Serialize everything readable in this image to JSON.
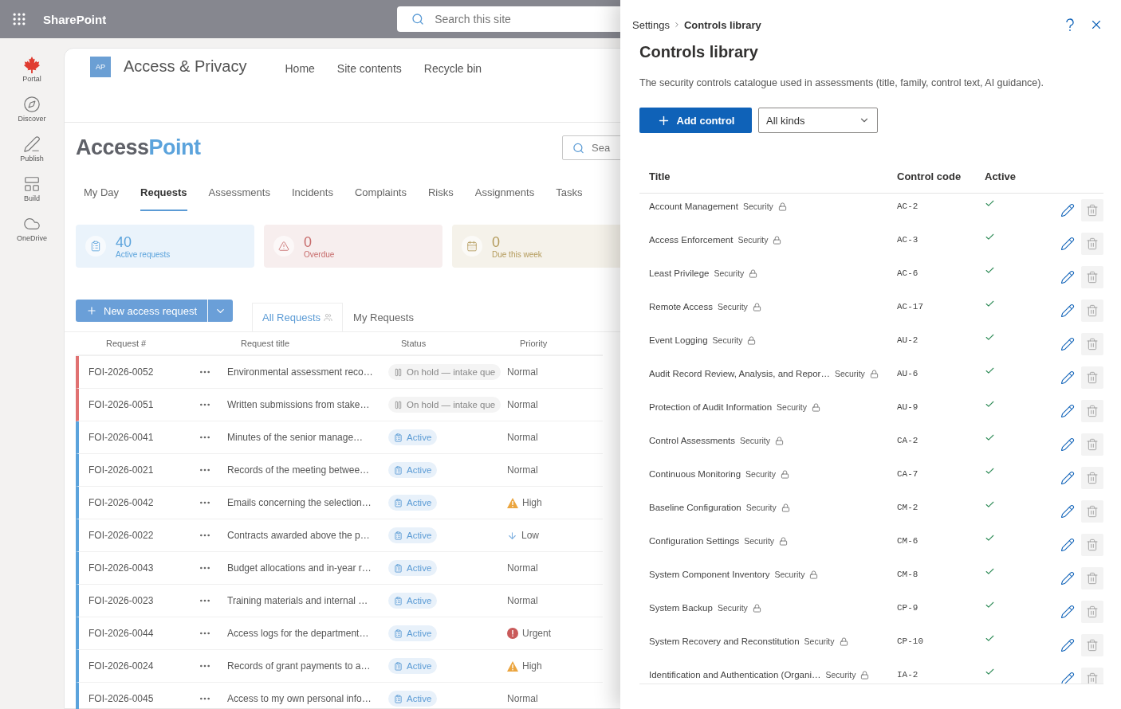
{
  "suite_bar": {
    "app_name": "SharePoint",
    "search": {
      "placeholder": "Search this site"
    }
  },
  "rail": [
    {
      "label": "Portal",
      "kind": "portal"
    },
    {
      "label": "Discover",
      "kind": "discover"
    },
    {
      "label": "Publish",
      "kind": "publish"
    },
    {
      "label": "Build",
      "kind": "build"
    },
    {
      "label": "OneDrive",
      "kind": "onedrive"
    }
  ],
  "site_header": {
    "logo": "AP",
    "title": "Access & Privacy",
    "nav": [
      "Home",
      "Site contents",
      "Recycle bin"
    ]
  },
  "app": {
    "brand": {
      "part1": "Access",
      "part2": "Point"
    },
    "search": {
      "placeholder": "Sea"
    },
    "tabs": [
      {
        "label": "My Day",
        "selected": false
      },
      {
        "label": "Requests",
        "selected": true
      },
      {
        "label": "Assessments",
        "selected": false
      },
      {
        "label": "Incidents",
        "selected": false
      },
      {
        "label": "Complaints",
        "selected": false
      },
      {
        "label": "Risks",
        "selected": false
      },
      {
        "label": "Assignments",
        "selected": false
      },
      {
        "label": "Tasks",
        "selected": false
      }
    ],
    "stats": [
      {
        "kind": "active",
        "value": "40",
        "label": "Active requests"
      },
      {
        "kind": "overdue",
        "value": "0",
        "label": "Overdue"
      },
      {
        "kind": "due",
        "value": "0",
        "label": "Due this week"
      }
    ],
    "new_button": "New access request",
    "views": [
      {
        "label": "All Requests",
        "selected": true
      },
      {
        "label": "My Requests",
        "selected": false
      }
    ],
    "table": {
      "columns": [
        "Request #",
        "Request title",
        "Status",
        "Priority"
      ],
      "rows": [
        {
          "id": "FOI-2026-0052",
          "title": "Environmental assessment reco…",
          "status": {
            "kind": "on_hold",
            "label": "On hold — intake que"
          },
          "priority": {
            "kind": "normal",
            "label": "Normal"
          }
        },
        {
          "id": "FOI-2026-0051",
          "title": "Written submissions from stake…",
          "status": {
            "kind": "on_hold",
            "label": "On hold — intake que"
          },
          "priority": {
            "kind": "normal",
            "label": "Normal"
          }
        },
        {
          "id": "FOI-2026-0041",
          "title": "Minutes of the senior manage…",
          "status": {
            "kind": "active",
            "label": "Active"
          },
          "priority": {
            "kind": "normal",
            "label": "Normal"
          }
        },
        {
          "id": "FOI-2026-0021",
          "title": "Records of the meeting betwee…",
          "status": {
            "kind": "active",
            "label": "Active"
          },
          "priority": {
            "kind": "normal",
            "label": "Normal"
          }
        },
        {
          "id": "FOI-2026-0042",
          "title": "Emails concerning the selection…",
          "status": {
            "kind": "active",
            "label": "Active"
          },
          "priority": {
            "kind": "high",
            "label": "High"
          }
        },
        {
          "id": "FOI-2026-0022",
          "title": "Contracts awarded above the p…",
          "status": {
            "kind": "active",
            "label": "Active"
          },
          "priority": {
            "kind": "low",
            "label": "Low"
          }
        },
        {
          "id": "FOI-2026-0043",
          "title": "Budget allocations and in-year r…",
          "status": {
            "kind": "active",
            "label": "Active"
          },
          "priority": {
            "kind": "normal",
            "label": "Normal"
          }
        },
        {
          "id": "FOI-2026-0023",
          "title": "Training materials and internal …",
          "status": {
            "kind": "active",
            "label": "Active"
          },
          "priority": {
            "kind": "normal",
            "label": "Normal"
          }
        },
        {
          "id": "FOI-2026-0044",
          "title": "Access logs for the department…",
          "status": {
            "kind": "active",
            "label": "Active"
          },
          "priority": {
            "kind": "urgent",
            "label": "Urgent"
          }
        },
        {
          "id": "FOI-2026-0024",
          "title": "Records of grant payments to a…",
          "status": {
            "kind": "active",
            "label": "Active"
          },
          "priority": {
            "kind": "high",
            "label": "High"
          }
        },
        {
          "id": "FOI-2026-0045",
          "title": "Access to my own personal info…",
          "status": {
            "kind": "active",
            "label": "Active"
          },
          "priority": {
            "kind": "normal",
            "label": "Normal"
          }
        }
      ]
    }
  },
  "panel": {
    "breadcrumb": [
      "Settings",
      "Controls library"
    ],
    "title": "Controls library",
    "description": "The security controls catalogue used in assessments (title, family, control text, AI guidance).",
    "add_button": "Add control",
    "filter": "All kinds",
    "columns": [
      "Title",
      "Control code",
      "Active"
    ],
    "rows": [
      {
        "title": "Account Management",
        "family": "Security",
        "code": "AC-2",
        "active": true
      },
      {
        "title": "Access Enforcement",
        "family": "Security",
        "code": "AC-3",
        "active": true
      },
      {
        "title": "Least Privilege",
        "family": "Security",
        "code": "AC-6",
        "active": true
      },
      {
        "title": "Remote Access",
        "family": "Security",
        "code": "AC-17",
        "active": true
      },
      {
        "title": "Event Logging",
        "family": "Security",
        "code": "AU-2",
        "active": true
      },
      {
        "title": "Audit Record Review, Analysis, and Repor…",
        "family": "Security",
        "code": "AU-6",
        "active": true
      },
      {
        "title": "Protection of Audit Information",
        "family": "Security",
        "code": "AU-9",
        "active": true
      },
      {
        "title": "Control Assessments",
        "family": "Security",
        "code": "CA-2",
        "active": true
      },
      {
        "title": "Continuous Monitoring",
        "family": "Security",
        "code": "CA-7",
        "active": true
      },
      {
        "title": "Baseline Configuration",
        "family": "Security",
        "code": "CM-2",
        "active": true
      },
      {
        "title": "Configuration Settings",
        "family": "Security",
        "code": "CM-6",
        "active": true
      },
      {
        "title": "System Component Inventory",
        "family": "Security",
        "code": "CM-8",
        "active": true
      },
      {
        "title": "System Backup",
        "family": "Security",
        "code": "CP-9",
        "active": true
      },
      {
        "title": "System Recovery and Reconstitution",
        "family": "Security",
        "code": "CP-10",
        "active": true
      },
      {
        "title": "Identification and Authentication (Organi…",
        "family": "Security",
        "code": "IA-2",
        "active": true
      }
    ]
  }
}
